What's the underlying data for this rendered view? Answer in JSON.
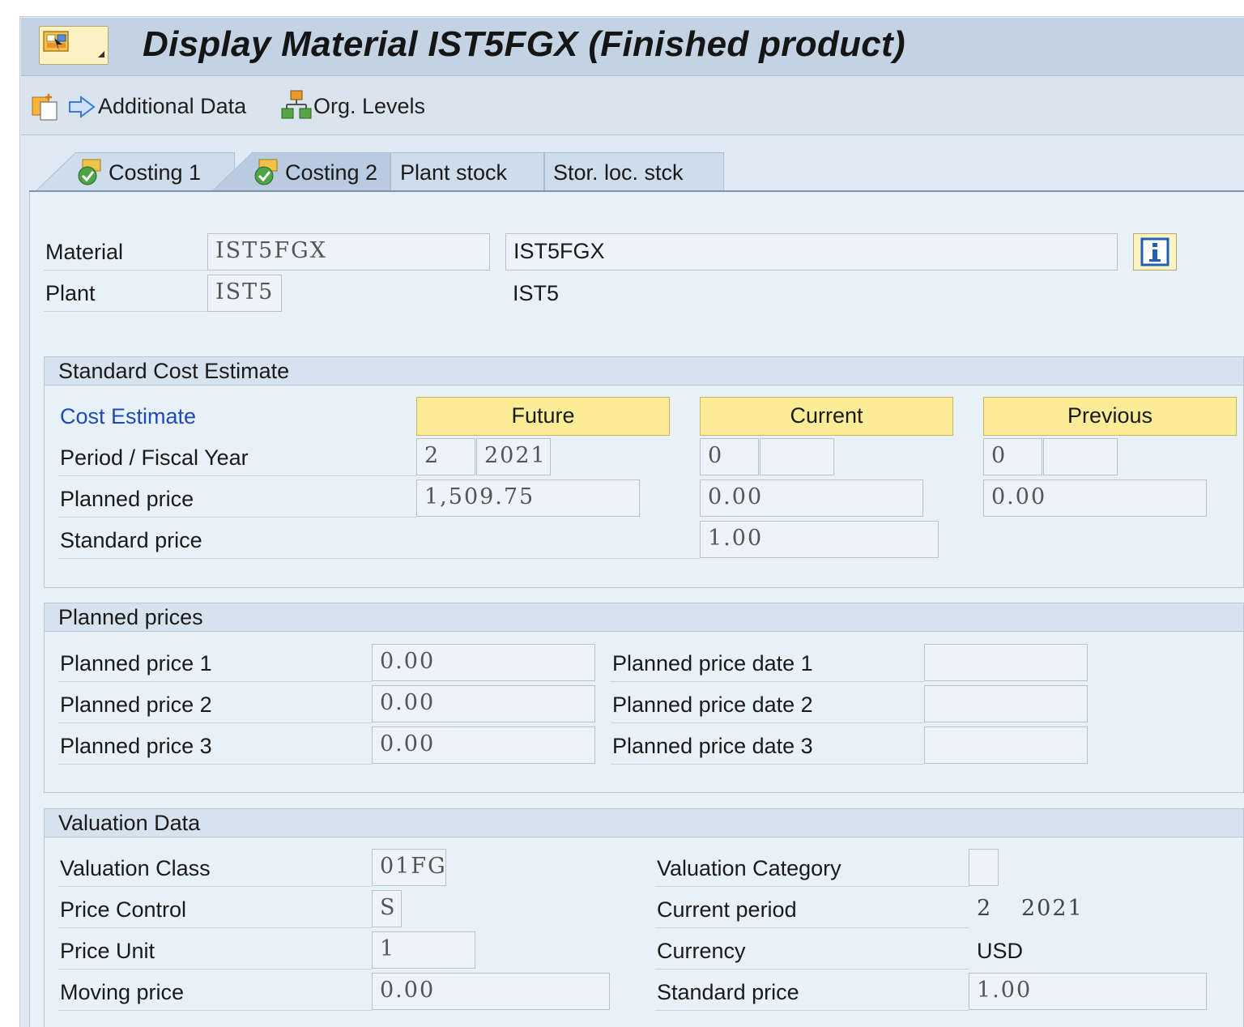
{
  "window": {
    "title": "Display Material IST5FGX (Finished product)"
  },
  "toolbar": {
    "additional_data": "Additional Data",
    "org_levels": "Org. Levels"
  },
  "tabs": [
    {
      "label": "Costing 1",
      "icon": "check-icon"
    },
    {
      "label": "Costing 2",
      "icon": "check-icon",
      "active": true
    },
    {
      "label": "Plant stock"
    },
    {
      "label": "Stor. loc. stck"
    }
  ],
  "header": {
    "material_label": "Material",
    "material_value": "IST5FGX",
    "material_description": "IST5FGX",
    "plant_label": "Plant",
    "plant_value": "IST5",
    "plant_description": "IST5"
  },
  "standard_cost_estimate": {
    "title": "Standard Cost Estimate",
    "cost_estimate_label": "Cost Estimate",
    "columns": [
      "Future",
      "Current",
      "Previous"
    ],
    "period_label": "Period / Fiscal Year",
    "planned_price_label": "Planned price",
    "standard_price_label": "Standard price",
    "future": {
      "period": "2",
      "year": "2021",
      "planned_price": "1,509.75"
    },
    "current": {
      "period": "0",
      "year": "",
      "planned_price": "0.00",
      "standard_price": "1.00"
    },
    "previous": {
      "period": "0",
      "year": "",
      "planned_price": "0.00"
    }
  },
  "planned_prices": {
    "title": "Planned prices",
    "rows": [
      {
        "price_label": "Planned price 1",
        "price": "0.00",
        "date_label": "Planned price date 1",
        "date": ""
      },
      {
        "price_label": "Planned price 2",
        "price": "0.00",
        "date_label": "Planned price date 2",
        "date": ""
      },
      {
        "price_label": "Planned price 3",
        "price": "0.00",
        "date_label": "Planned price date 3",
        "date": ""
      }
    ]
  },
  "valuation_data": {
    "title": "Valuation Data",
    "valuation_class_label": "Valuation Class",
    "valuation_class": "01FG",
    "price_control_label": "Price Control",
    "price_control": "S",
    "price_unit_label": "Price Unit",
    "price_unit": "1",
    "moving_price_label": "Moving price",
    "moving_price": "0.00",
    "valuation_category_label": "Valuation Category",
    "valuation_category": "",
    "current_period_label": "Current period",
    "current_period": "2",
    "current_year": "2021",
    "currency_label": "Currency",
    "currency": "USD",
    "standard_price_label": "Standard price",
    "standard_price": "1.00"
  },
  "colors": {
    "highlight_header": "#fbec95",
    "link": "#1f4bb4",
    "title_bar": "#c3d3e4"
  }
}
